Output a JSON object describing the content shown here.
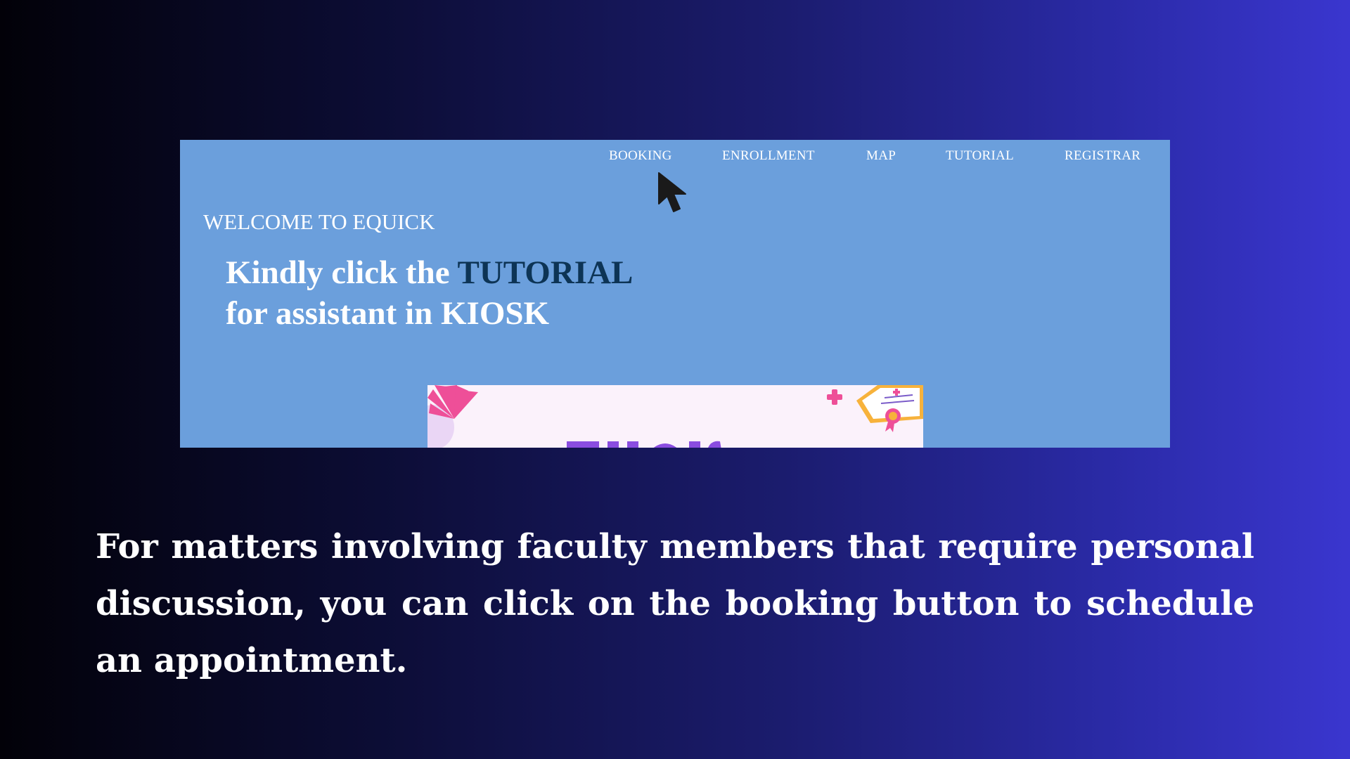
{
  "nav": {
    "items": [
      {
        "label": "BOOKING"
      },
      {
        "label": "ENROLLMENT"
      },
      {
        "label": "MAP"
      },
      {
        "label": "TUTORIAL"
      },
      {
        "label": "REGISTRAR"
      }
    ]
  },
  "hero": {
    "welcome": "WELCOME TO EQUICK",
    "line1_prefix": "Kindly click the ",
    "line1_highlight": "TUTORIAL",
    "line2": "for assistant in KIOSK"
  },
  "caption": {
    "text": "For matters involving faculty members that require personal discussion, you can click on the booking button to schedule an appointment."
  },
  "colors": {
    "page_bg_start": "#020108",
    "page_bg_end": "#3a36cf",
    "screenshot_bg": "#6b9fdc",
    "highlight_text": "#0d3455",
    "banner_bg": "#fbf2fb",
    "banner_accent": "#8a4de0"
  },
  "icons": {
    "cursor": "mouse-pointer-icon",
    "leaf": "leaf-decoration-icon",
    "plus": "plus-icon",
    "certificate": "certificate-icon"
  }
}
